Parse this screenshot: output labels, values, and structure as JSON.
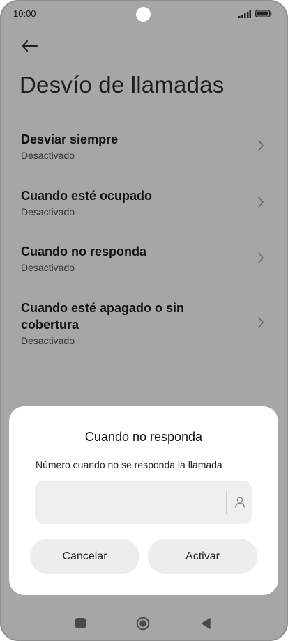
{
  "status_bar": {
    "time": "10:00"
  },
  "header": {
    "title": "Desvío de llamadas"
  },
  "settings": {
    "items": [
      {
        "title": "Desviar siempre",
        "status": "Desactivado"
      },
      {
        "title": "Cuando esté ocupado",
        "status": "Desactivado"
      },
      {
        "title": "Cuando no responda",
        "status": "Desactivado"
      },
      {
        "title": "Cuando esté apagado o sin cobertura",
        "status": "Desactivado"
      }
    ]
  },
  "dialog": {
    "title": "Cuando no responda",
    "label": "Número cuando no se responda la llamada",
    "input_value": "",
    "cancel_label": "Cancelar",
    "activate_label": "Activar"
  },
  "icons": {
    "back": "arrow-left-icon",
    "chevron": "chevron-right-icon",
    "contact": "person-icon",
    "nav_recents": "square-icon",
    "nav_home": "circle-icon",
    "nav_back": "triangle-back-icon"
  },
  "colors": {
    "scrim": "#a6a6a6",
    "dialog_bg": "#ffffff",
    "button_bg": "#ededed",
    "input_bg": "#efefef"
  }
}
